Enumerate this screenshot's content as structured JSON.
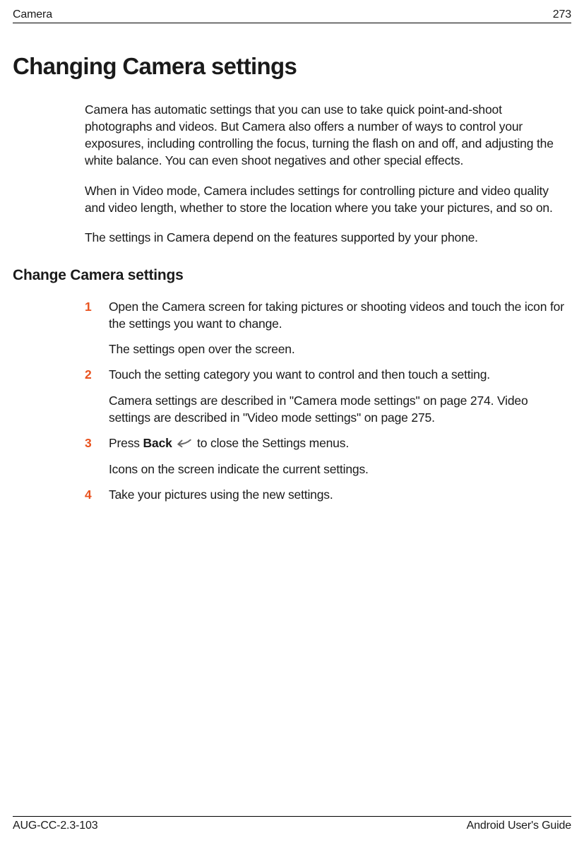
{
  "header": {
    "left": "Camera",
    "right": "273"
  },
  "main_heading": "Changing Camera settings",
  "intro": {
    "p1": "Camera has automatic settings that you can use to take quick point-and-shoot photographs and videos. But Camera also offers a number of ways to control your exposures, including controlling the focus, turning the flash on and off, and adjusting the white balance. You can even shoot negatives and other special effects.",
    "p2": "When in Video mode, Camera includes settings for controlling picture and video quality and video length, whether to store the location where you take your pictures, and so on.",
    "p3": "The settings in Camera depend on the features supported by your phone."
  },
  "sub_heading": "Change Camera settings",
  "steps": [
    {
      "num": "1",
      "lines": [
        "Open the Camera screen for taking pictures or shooting videos and touch the icon for the settings you want to change.",
        "The settings open over the screen."
      ]
    },
    {
      "num": "2",
      "lines": [
        "Touch the setting category you want to control and then touch a setting.",
        "Camera settings are described in \"Camera mode settings\" on page 274. Video settings are described in \"Video mode settings\" on page 275."
      ]
    },
    {
      "num": "3",
      "pre": "Press ",
      "bold": "Back",
      "post": " to close the Settings menus.",
      "extra": "Icons on the screen indicate the current settings."
    },
    {
      "num": "4",
      "lines": [
        "Take your pictures using the new settings."
      ]
    }
  ],
  "footer": {
    "left": "AUG-CC-2.3-103",
    "right": "Android User's Guide"
  }
}
